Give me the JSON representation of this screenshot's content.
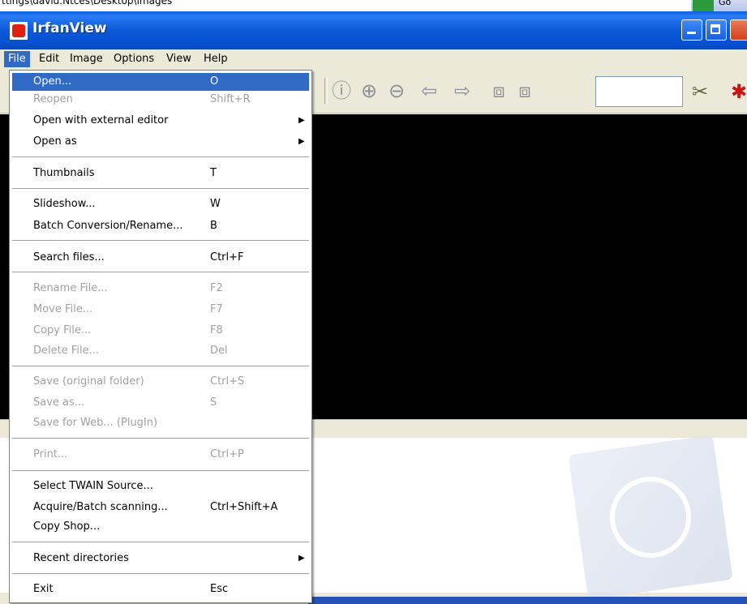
{
  "background": {
    "path_text": "ttings\\david.Ntces\\Desktop\\images",
    "go_label": "Go"
  },
  "window": {
    "title": "IrfanView"
  },
  "menubar": [
    {
      "label": "File"
    },
    {
      "label": "Edit"
    },
    {
      "label": "Image"
    },
    {
      "label": "Options"
    },
    {
      "label": "View"
    },
    {
      "label": "Help"
    }
  ],
  "toolbar": {
    "icons": [
      "info-icon",
      "zoom-in-icon",
      "zoom-out-icon",
      "previous-arrow-icon",
      "next-arrow-icon",
      "page-up-icon",
      "page-down-icon",
      "tools-icon",
      "bug-icon"
    ],
    "zoom_value": ""
  },
  "file_menu": {
    "items": [
      {
        "label": "Open...",
        "shortcut": "O",
        "submenu": false,
        "enabled": true
      },
      {
        "label": "Reopen",
        "shortcut": "Shift+R",
        "submenu": false,
        "enabled": false
      },
      {
        "label": "Open with external editor",
        "shortcut": "",
        "submenu": true,
        "enabled": true
      },
      {
        "label": "Open as",
        "shortcut": "",
        "submenu": true,
        "enabled": true
      },
      {
        "label": "Thumbnails",
        "shortcut": "T",
        "submenu": false,
        "enabled": true
      },
      {
        "label": "Slideshow...",
        "shortcut": "W",
        "submenu": false,
        "enabled": true
      },
      {
        "label": "Batch Conversion/Rename...",
        "shortcut": "B",
        "submenu": false,
        "enabled": true
      },
      {
        "label": "Search files...",
        "shortcut": "Ctrl+F",
        "submenu": false,
        "enabled": true
      },
      {
        "label": "Rename File...",
        "shortcut": "F2",
        "submenu": false,
        "enabled": false
      },
      {
        "label": "Move File...",
        "shortcut": "F7",
        "submenu": false,
        "enabled": false
      },
      {
        "label": "Copy File...",
        "shortcut": "F8",
        "submenu": false,
        "enabled": false
      },
      {
        "label": "Delete File...",
        "shortcut": "Del",
        "submenu": false,
        "enabled": false
      },
      {
        "label": "Save (original folder)",
        "shortcut": "Ctrl+S",
        "submenu": false,
        "enabled": false
      },
      {
        "label": "Save as...",
        "shortcut": "S",
        "submenu": false,
        "enabled": false
      },
      {
        "label": "Save for Web... (PlugIn)",
        "shortcut": "",
        "submenu": false,
        "enabled": false
      },
      {
        "label": "Print...",
        "shortcut": "Ctrl+P",
        "submenu": false,
        "enabled": false
      },
      {
        "label": "Select TWAIN Source...",
        "shortcut": "",
        "submenu": false,
        "enabled": true
      },
      {
        "label": "Acquire/Batch scanning...",
        "shortcut": "Ctrl+Shift+A",
        "submenu": false,
        "enabled": true
      },
      {
        "label": "Copy Shop...",
        "shortcut": "",
        "submenu": false,
        "enabled": true
      },
      {
        "label": "Recent directories",
        "shortcut": "",
        "submenu": true,
        "enabled": true
      },
      {
        "label": "Exit",
        "shortcut": "Esc",
        "submenu": false,
        "enabled": true
      }
    ]
  },
  "colors": {
    "highlight": "#316ac5",
    "titlebar": "#0b5ad8",
    "menu_bg": "#ece9d8",
    "disabled_text": "#a0a0a0"
  }
}
